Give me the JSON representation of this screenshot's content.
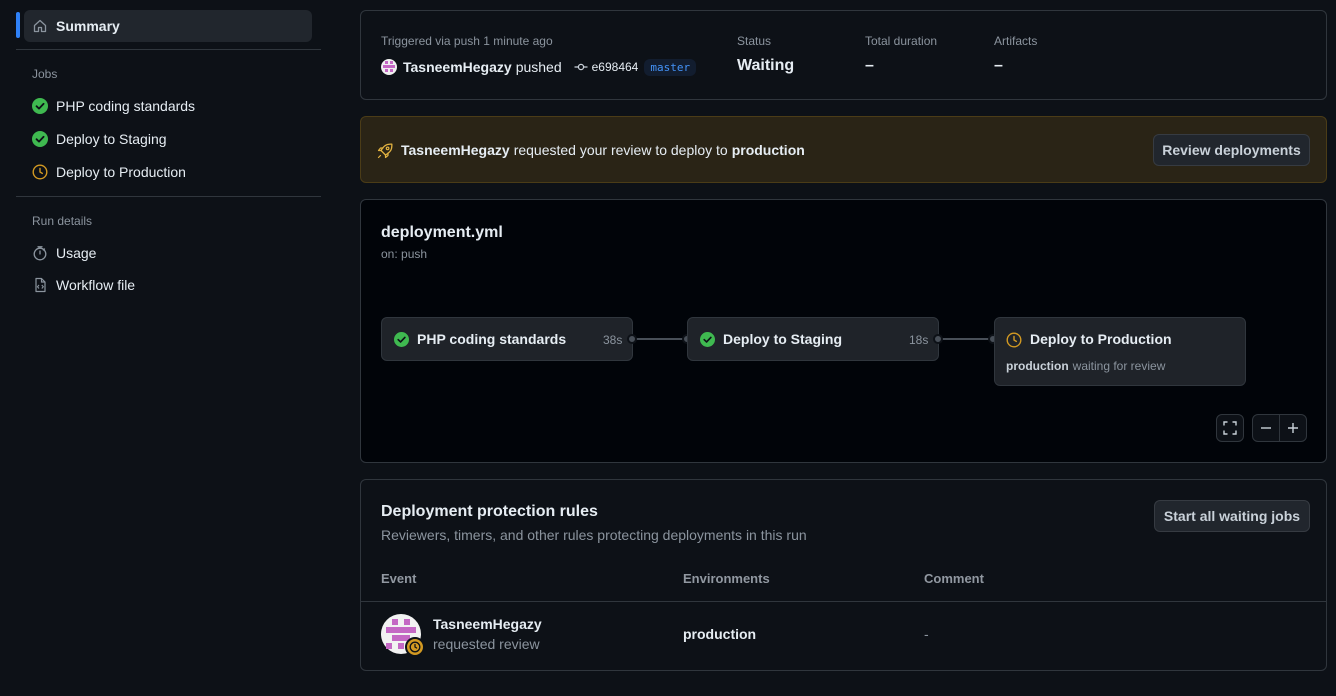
{
  "sidebar": {
    "summary": "Summary",
    "jobs_heading": "Jobs",
    "jobs": [
      {
        "label": "PHP coding standards",
        "status": "success"
      },
      {
        "label": "Deploy to Staging",
        "status": "success"
      },
      {
        "label": "Deploy to Production",
        "status": "waiting"
      }
    ],
    "run_details_heading": "Run details",
    "usage": "Usage",
    "workflow_file": "Workflow file"
  },
  "summary": {
    "trigger": "Triggered via push 1 minute ago",
    "actor": "TasneemHegazy",
    "action": "pushed",
    "commit": "e698464",
    "branch": "master",
    "status_label": "Status",
    "status_value": "Waiting",
    "duration_label": "Total duration",
    "duration_value": "–",
    "artifacts_label": "Artifacts",
    "artifacts_value": "–"
  },
  "review_banner": {
    "actor": "TasneemHegazy",
    "text": "requested your review to deploy to",
    "environment": "production",
    "button": "Review deployments"
  },
  "graph": {
    "file": "deployment.yml",
    "trigger": "on: push",
    "jobs": [
      {
        "name": "PHP coding standards",
        "time": "38s",
        "status": "success"
      },
      {
        "name": "Deploy to Staging",
        "time": "18s",
        "status": "success"
      },
      {
        "name": "Deploy to Production",
        "status": "waiting",
        "env": "production",
        "note": "waiting for review"
      }
    ]
  },
  "protection": {
    "title": "Deployment protection rules",
    "subtitle": "Reviewers, timers, and other rules protecting deployments in this run",
    "button": "Start all waiting jobs",
    "columns": [
      "Event",
      "Environments",
      "Comment"
    ],
    "rows": [
      {
        "actor": "TasneemHegazy",
        "event": "requested review",
        "environment": "production",
        "comment": "-"
      }
    ]
  },
  "colors": {
    "success": "#3fb950",
    "waiting": "#d29922",
    "accent": "#2f81f7",
    "banner_bg": "#2a2416"
  }
}
